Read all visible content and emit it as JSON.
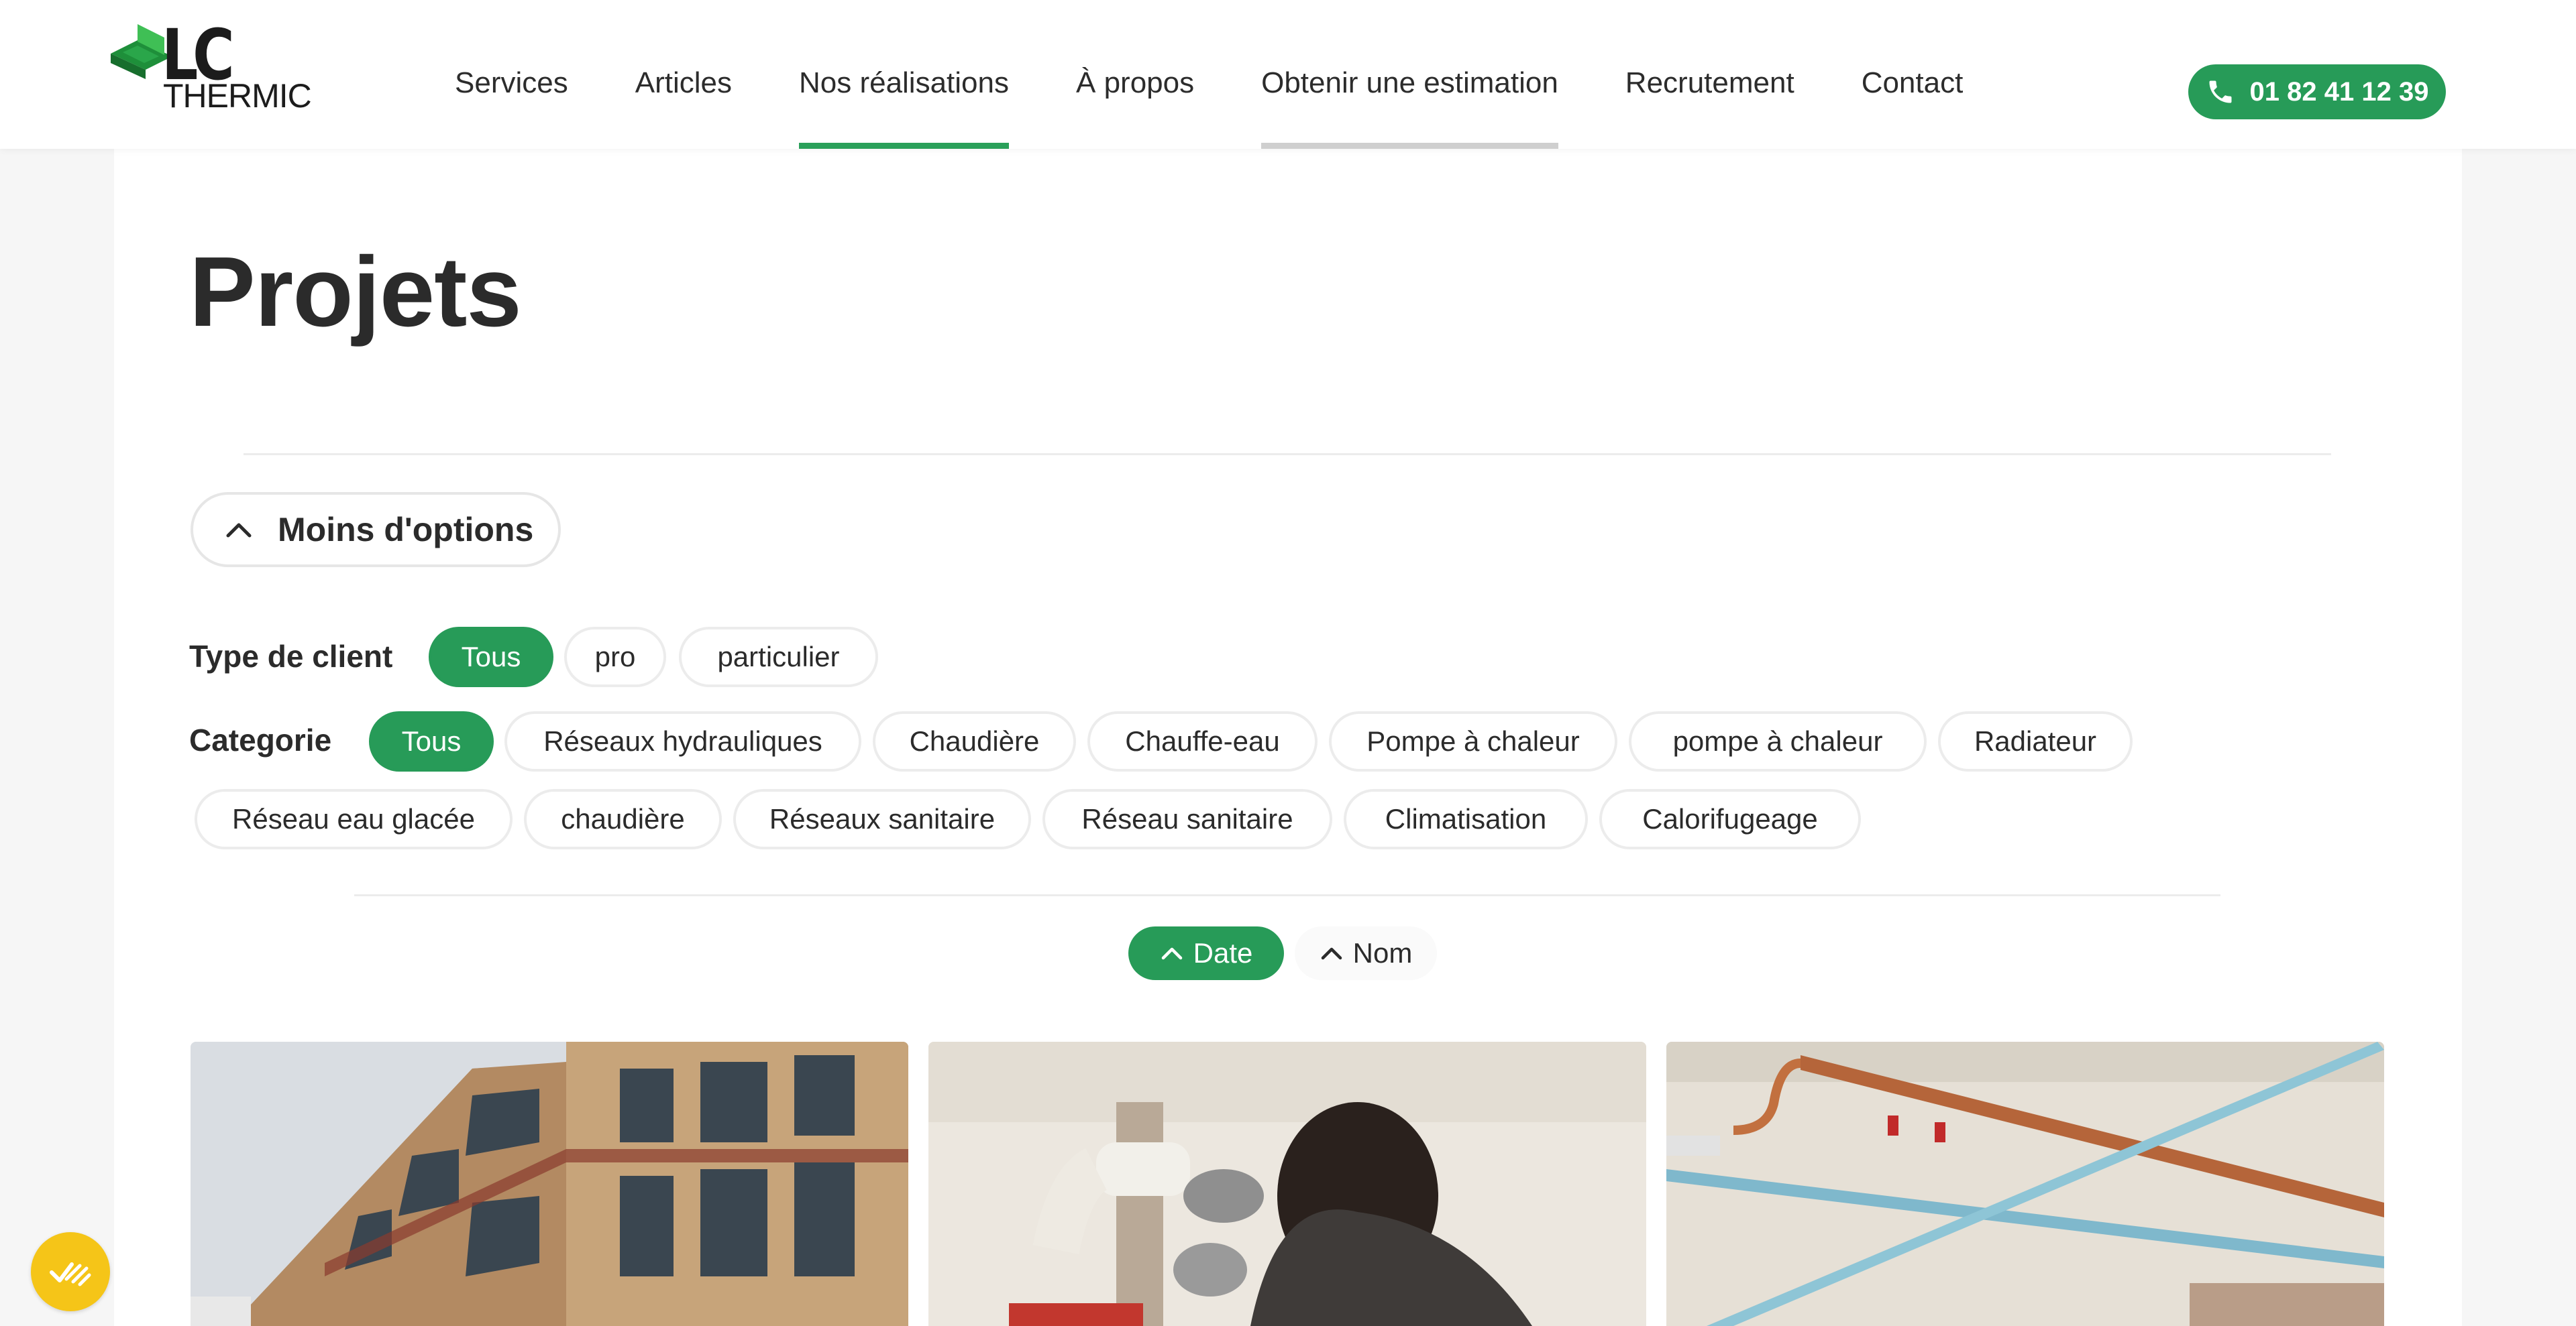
{
  "brand": {
    "name": "LC",
    "sub": "THERMIC"
  },
  "nav": {
    "services": "Services",
    "articles": "Articles",
    "realisations": "Nos réalisations",
    "apropos": "À propos",
    "estimation": "Obtenir une estimation",
    "recrutement": "Recrutement",
    "contact": "Contact"
  },
  "phone": {
    "number": "01 82 41 12 39"
  },
  "page": {
    "title": "Projets"
  },
  "options": {
    "toggle_label": "Moins d'options"
  },
  "filters": {
    "client_type": {
      "label": "Type de client",
      "chips": [
        "Tous",
        "pro",
        "particulier"
      ]
    },
    "category": {
      "label": "Categorie",
      "chips": [
        "Tous",
        "Réseaux hydrauliques",
        "Chaudière",
        "Chauffe-eau",
        "Pompe à chaleur",
        "pompe à chaleur",
        "Radiateur",
        "Réseau eau glacée",
        "chaudière",
        "Réseaux sanitaire",
        "Réseau sanitaire",
        "Climatisation",
        "Calorifugeage"
      ]
    }
  },
  "sort": {
    "date": "Date",
    "name": "Nom"
  },
  "colors": {
    "accent": "#279b58",
    "badge": "#f5c518"
  },
  "icons": {
    "phone": "phone-icon",
    "chevron": "chevron-up-icon",
    "badge": "cookie-consent-icon"
  }
}
